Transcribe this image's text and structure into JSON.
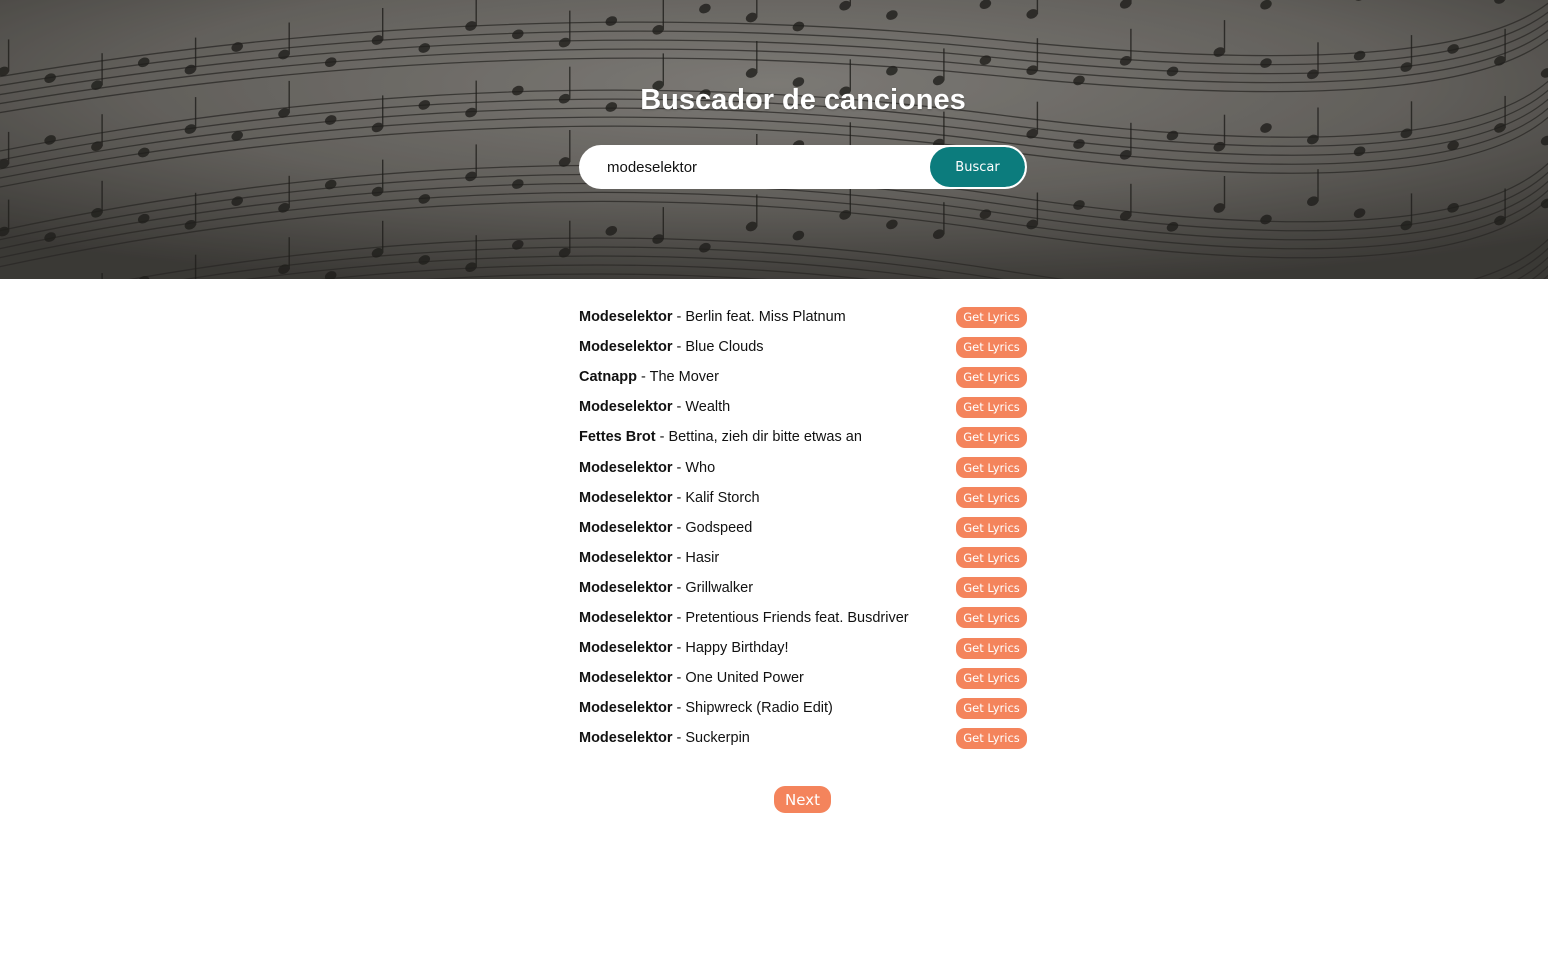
{
  "header": {
    "title": "Buscador de canciones",
    "background_image": "sheet-music-photo"
  },
  "search": {
    "value": "modeselektor",
    "button_label": "Buscar"
  },
  "results": [
    {
      "artist": "Modeselektor",
      "separator": " - ",
      "song": "Berlin feat. Miss Platnum",
      "button": "Get Lyrics"
    },
    {
      "artist": "Modeselektor",
      "separator": " - ",
      "song": "Blue Clouds",
      "button": "Get Lyrics"
    },
    {
      "artist": "Catnapp",
      "separator": " - ",
      "song": "The Mover",
      "button": "Get Lyrics"
    },
    {
      "artist": "Modeselektor",
      "separator": " - ",
      "song": "Wealth",
      "button": "Get Lyrics"
    },
    {
      "artist": "Fettes Brot",
      "separator": " - ",
      "song": "Bettina, zieh dir bitte etwas an",
      "button": "Get Lyrics"
    },
    {
      "artist": "Modeselektor",
      "separator": " - ",
      "song": "Who",
      "button": "Get Lyrics"
    },
    {
      "artist": "Modeselektor",
      "separator": " - ",
      "song": "Kalif Storch",
      "button": "Get Lyrics"
    },
    {
      "artist": "Modeselektor",
      "separator": " - ",
      "song": "Godspeed",
      "button": "Get Lyrics"
    },
    {
      "artist": "Modeselektor",
      "separator": " - ",
      "song": "Hasir",
      "button": "Get Lyrics"
    },
    {
      "artist": "Modeselektor",
      "separator": " - ",
      "song": "Grillwalker",
      "button": "Get Lyrics"
    },
    {
      "artist": "Modeselektor",
      "separator": " - ",
      "song": "Pretentious Friends feat. Busdriver",
      "button": "Get Lyrics"
    },
    {
      "artist": "Modeselektor",
      "separator": " - ",
      "song": "Happy Birthday!",
      "button": "Get Lyrics"
    },
    {
      "artist": "Modeselektor",
      "separator": " - ",
      "song": "One United Power",
      "button": "Get Lyrics"
    },
    {
      "artist": "Modeselektor",
      "separator": " - ",
      "song": "Shipwreck (Radio Edit)",
      "button": "Get Lyrics"
    },
    {
      "artist": "Modeselektor",
      "separator": " - ",
      "song": "Suckerpin",
      "button": "Get Lyrics"
    }
  ],
  "pagination": {
    "next_label": "Next"
  },
  "colors": {
    "accent_button": "#f4845c",
    "search_button": "#0c7c7d",
    "text": "#111111"
  }
}
